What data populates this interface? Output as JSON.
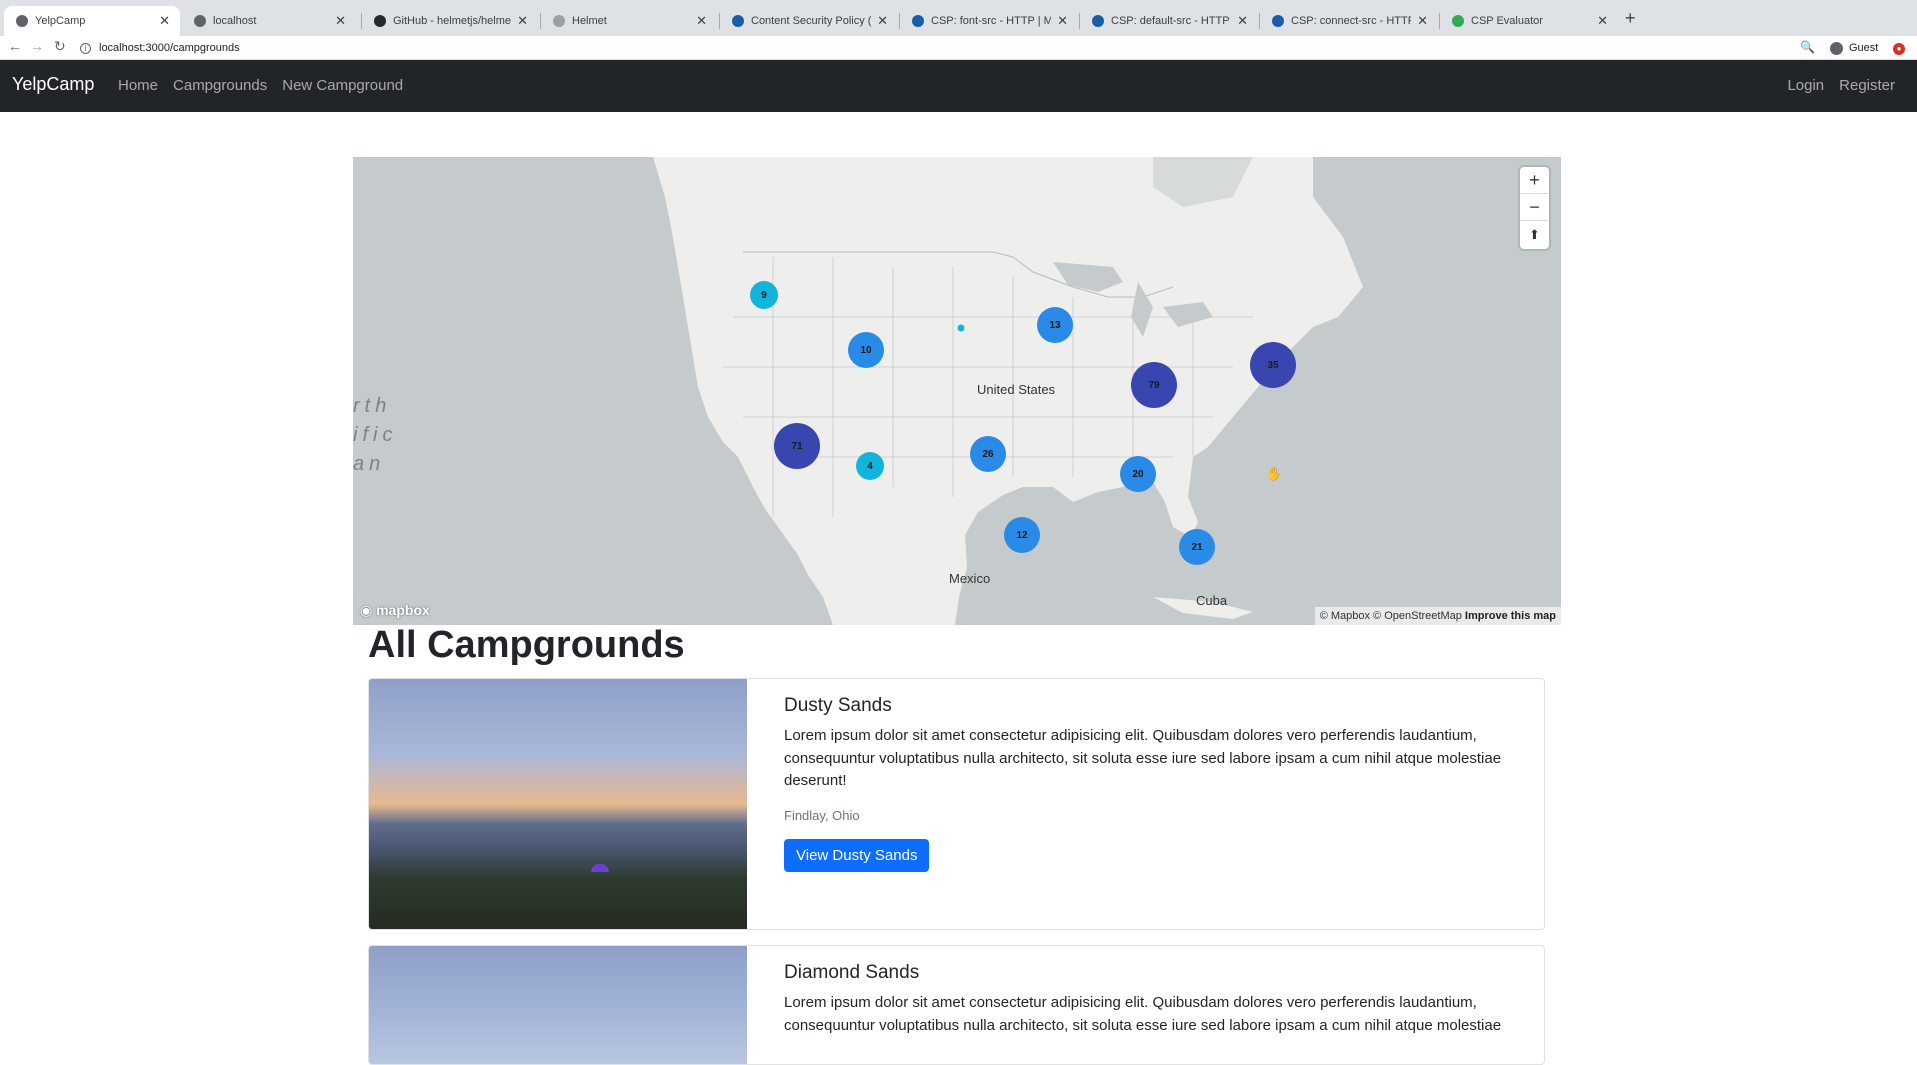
{
  "browser": {
    "tabs": [
      {
        "title": "YelpCamp",
        "active": true
      },
      {
        "title": "localhost",
        "active": false
      },
      {
        "title": "GitHub - helmetjs/helmet: Help",
        "active": false
      },
      {
        "title": "Helmet",
        "active": false
      },
      {
        "title": "Content Security Policy (CSP)",
        "active": false
      },
      {
        "title": "CSP: font-src - HTTP | MDN",
        "active": false
      },
      {
        "title": "CSP: default-src - HTTP | MDN",
        "active": false
      },
      {
        "title": "CSP: connect-src - HTTP | MDN",
        "active": false
      },
      {
        "title": "CSP Evaluator",
        "active": false
      }
    ],
    "new_tab": "+",
    "url": "localhost:3000/campgrounds",
    "profile_label": "Guest"
  },
  "navbar": {
    "brand": "YelpCamp",
    "links": [
      "Home",
      "Campgrounds",
      "New Campground"
    ],
    "right_links": [
      "Login",
      "Register"
    ]
  },
  "map": {
    "labels": {
      "country": "United States",
      "mexico": "Mexico",
      "cuba": "Cuba",
      "ocean": "rth\nific\nan"
    },
    "clusters": [
      {
        "count": "9",
        "color": "#11b4da"
      },
      {
        "count": "10",
        "color": "#2a8ae8"
      },
      {
        "count": "13",
        "color": "#2a8ae8"
      },
      {
        "count": "79",
        "color": "#3a46b0"
      },
      {
        "count": "35",
        "color": "#3a46b0"
      },
      {
        "count": "71",
        "color": "#3a46b0"
      },
      {
        "count": "4",
        "color": "#11b4da"
      },
      {
        "count": "26",
        "color": "#2a8ae8"
      },
      {
        "count": "20",
        "color": "#2a8ae8"
      },
      {
        "count": "12",
        "color": "#2a8ae8"
      },
      {
        "count": "21",
        "color": "#2a8ae8"
      }
    ],
    "controls": {
      "zoom_in": "+",
      "zoom_out": "−",
      "compass": "⬆"
    },
    "logo": "mapbox",
    "attribution": "© Mapbox © OpenStreetMap",
    "improve": "Improve this map"
  },
  "page": {
    "heading": "All Campgrounds"
  },
  "campgrounds": [
    {
      "title": "Dusty Sands",
      "description": "Lorem ipsum dolor sit amet consectetur adipisicing elit. Quibusdam dolores vero perferendis laudantium, consequuntur voluptatibus nulla architecto, sit soluta esse iure sed labore ipsam a cum nihil atque molestiae deserunt!",
      "location": "Findlay, Ohio",
      "button": "View Dusty Sands"
    },
    {
      "title": "Diamond Sands",
      "description": "Lorem ipsum dolor sit amet consectetur adipisicing elit. Quibusdam dolores vero perferendis laudantium, consequuntur voluptatibus nulla architecto, sit soluta esse iure sed labore ipsam a cum nihil atque molestiae"
    }
  ]
}
